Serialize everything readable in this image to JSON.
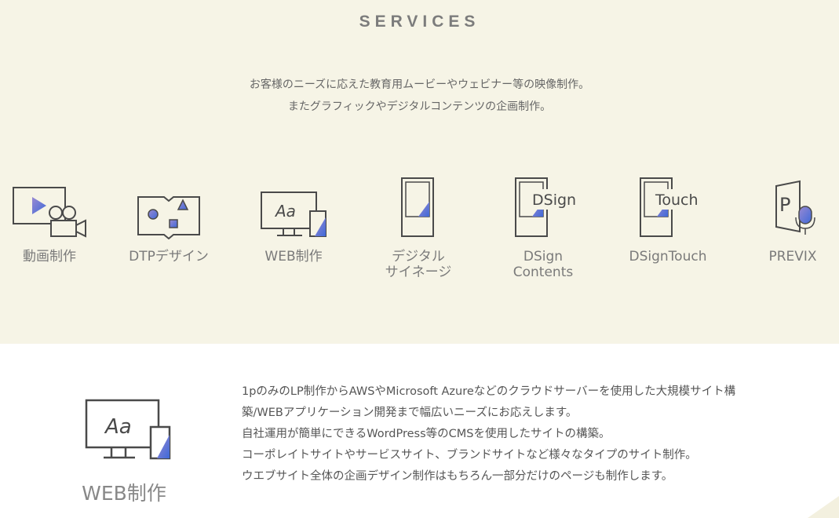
{
  "section": {
    "title": "SERVICES",
    "intro": [
      "お客様のニーズに応えた教育用ムービーやウェビナー等の映像制作。",
      "またグラフィックやデジタルコンテンツの企画制作。"
    ]
  },
  "services": [
    {
      "label": "動画制作",
      "icon": "video-camera-icon"
    },
    {
      "label": "DTPデザイン",
      "icon": "dtp-brochure-icon"
    },
    {
      "label": "WEB制作",
      "icon": "web-monitor-icon"
    },
    {
      "label": "デジタル\nサイネージ",
      "icon": "signage-icon"
    },
    {
      "label": "DSign\nContents",
      "icon": "dsign-contents-icon",
      "icon_text": "DSign"
    },
    {
      "label": "DSignTouch",
      "icon": "dsign-touch-icon",
      "icon_text": "Touch"
    },
    {
      "label": "PREVIX",
      "icon": "previx-mic-icon",
      "icon_text": "P"
    }
  ],
  "detail": {
    "label": "WEB制作",
    "icon": "web-monitor-icon",
    "icon_text": "Aa",
    "lines": [
      "1pのみのLP制作からAWSやMicrosoft Azureなどのクラウドサーバーを使用した大規模サイト構",
      "築/WEBアプリケーション開発まで幅広いニーズにお応えします。",
      "自社運用が簡単にできるWordPress等のCMSを使用したサイトの構築。",
      "コーポレイトサイトやサービスサイト、ブランドサイトなど様々なタイプのサイト制作。",
      "ウエブサイト全体の企画デザイン制作はもちろん一部分だけのページも制作します。"
    ]
  },
  "colors": {
    "background_top": "#f6f4e6",
    "icon_stroke": "#4a4a4a",
    "accent_blue": "#3f69d8",
    "accent_purple": "#9a8ad2"
  }
}
